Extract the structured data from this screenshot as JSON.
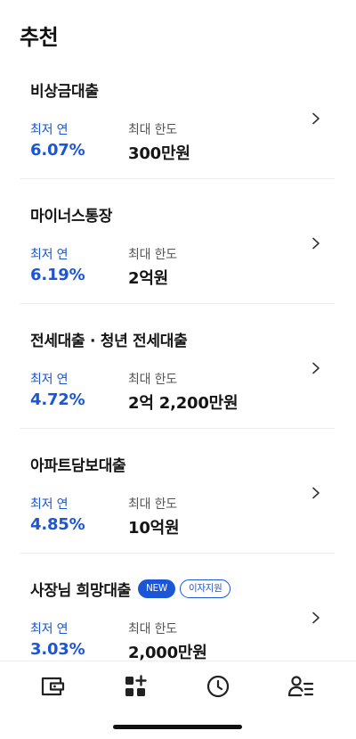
{
  "section": {
    "title": "추천"
  },
  "cards": [
    {
      "title": "비상금대출",
      "rate_label": "최저 연",
      "rate": "6.07%",
      "limit_label": "최대 한도",
      "limit": "300만원"
    },
    {
      "title": "마이너스통장",
      "rate_label": "최저 연",
      "rate": "6.19%",
      "limit_label": "최대 한도",
      "limit": "2억원"
    },
    {
      "title": "전세대출 · 청년 전세대출",
      "rate_label": "최저 연",
      "rate": "4.72%",
      "limit_label": "최대 한도",
      "limit": "2억 2,200만원"
    },
    {
      "title": "아파트담보대출",
      "rate_label": "최저 연",
      "rate": "4.85%",
      "limit_label": "최대 한도",
      "limit": "10억원"
    },
    {
      "title": "사장님 희망대출",
      "badge_new": "NEW",
      "badge_tag": "이자지원",
      "rate_label": "최저 연",
      "rate": "3.03%",
      "limit_label": "최대 한도",
      "limit": "2,000만원"
    }
  ],
  "tabbar": {
    "icons": [
      "wallet-icon",
      "apps-plus-icon",
      "clock-icon",
      "user-list-icon"
    ]
  },
  "colors": {
    "accent": "#1a56d6",
    "text": "#151515",
    "divider": "#ececec"
  }
}
